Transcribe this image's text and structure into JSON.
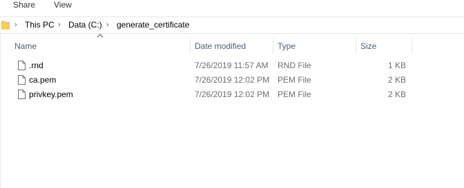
{
  "ribbon": {
    "tabs": [
      "Share",
      "View"
    ]
  },
  "address": {
    "crumbs": [
      "This PC",
      "Data (C:)",
      "generate_certificate"
    ]
  },
  "columns": {
    "name": "Name",
    "date": "Date modified",
    "type": "Type",
    "size": "Size"
  },
  "files": [
    {
      "name": ".rnd",
      "date": "7/26/2019 11:57 AM",
      "type": "RND File",
      "size": "1 KB"
    },
    {
      "name": "ca.pem",
      "date": "7/26/2019 12:02 PM",
      "type": "PEM File",
      "size": "2 KB"
    },
    {
      "name": "privkey.pem",
      "date": "7/26/2019 12:02 PM",
      "type": "PEM File",
      "size": "2 KB"
    }
  ],
  "colors": {
    "folder": "#f5cf5b",
    "header_text": "#4c607a",
    "separator": "#e5e5e5"
  }
}
